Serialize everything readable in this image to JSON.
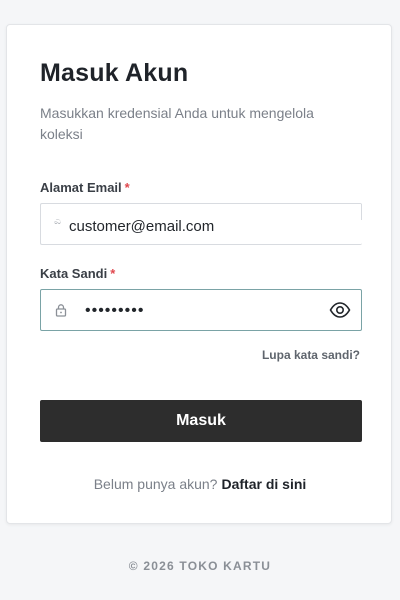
{
  "login": {
    "title": "Masuk Akun",
    "subtitle": "Masukkan kredensial Anda untuk mengelola koleksi",
    "required_mark": "*",
    "email": {
      "label": "Alamat Email",
      "value": "customer@email.com",
      "icon_glyph": "ಎ",
      "icon": "email-icon"
    },
    "password": {
      "label": "Kata Sandi",
      "value": "password1",
      "icon": "lock-icon",
      "toggle_icon": "eye-icon"
    },
    "forgot_link": "Lupa kata sandi?",
    "submit_label": "Masuk",
    "register_prompt": "Belum punya akun?",
    "register_link": "Daftar di sini"
  },
  "footer": {
    "copyright": "© 2026 TOKO KARTU"
  },
  "colors": {
    "page_bg": "#f5f6f8",
    "card_bg": "#ffffff",
    "primary_button": "#2d2d2d",
    "required": "#e0484e",
    "focus_border": "#7aa3a6",
    "muted_text": "#7b8089"
  }
}
